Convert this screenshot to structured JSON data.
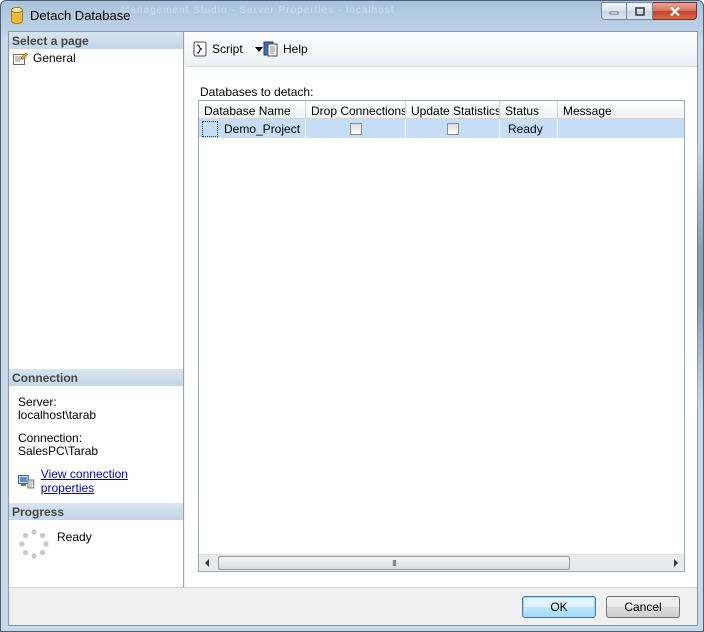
{
  "window": {
    "title": "Detach Database",
    "ghost_title": "Management Studio  -  Server Properties  -  localhost"
  },
  "toolbar": {
    "script_label": "Script",
    "help_label": "Help"
  },
  "left_panel": {
    "select_page_header": "Select a page",
    "pages": [
      {
        "label": "General"
      }
    ],
    "connection_header": "Connection",
    "server_label": "Server:",
    "server_value": "localhost\\tarab",
    "connection_label": "Connection:",
    "connection_value": "SalesPC\\Tarab",
    "view_props_link": "View connection properties",
    "progress_header": "Progress",
    "progress_status": "Ready"
  },
  "main": {
    "databases_label": "Databases to detach:",
    "columns": [
      "Database Name",
      "Drop Connections",
      "Update Statistics",
      "Status",
      "Message"
    ],
    "rows": [
      {
        "database_name": "Demo_Project",
        "drop_connections": false,
        "update_statistics": false,
        "status": "Ready",
        "message": ""
      }
    ],
    "scroll_thumb_grip": "III"
  },
  "buttons": {
    "ok_label": "OK",
    "cancel_label": "Cancel"
  },
  "colors": {
    "selection_row": "#c5def5",
    "header_gradient": "#c5d5e7",
    "link": "#0000cc"
  }
}
